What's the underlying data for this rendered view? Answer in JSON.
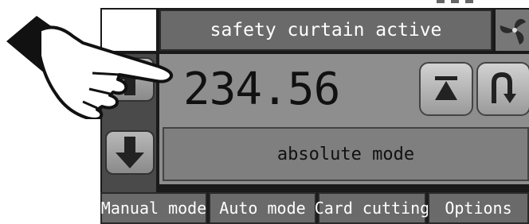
{
  "status": {
    "message": "safety curtain active"
  },
  "position": {
    "value": "234.56"
  },
  "mode": {
    "label": "absolute mode"
  },
  "tabs": [
    {
      "label": "Manual mode"
    },
    {
      "label": "Auto mode"
    },
    {
      "label": "Card cutting"
    },
    {
      "label": "Options"
    }
  ],
  "icons": {
    "fan": "fan-icon",
    "up": "arrow-up-icon",
    "down": "arrow-down-icon",
    "home": "home-icon",
    "return": "return-icon",
    "hand": "pointing-hand-icon"
  },
  "colors": {
    "status_bar": "#6a6a6a",
    "panel": "#8e8e8e",
    "frame": "#1a1a1a"
  }
}
